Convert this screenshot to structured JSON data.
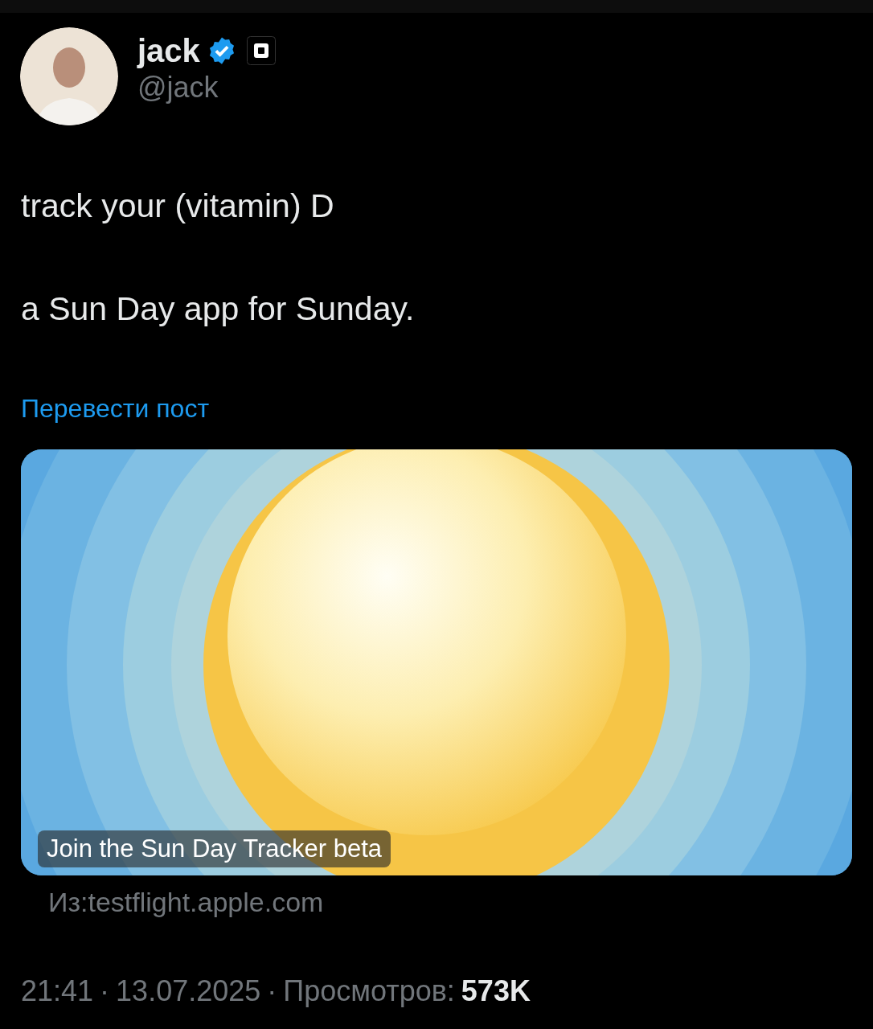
{
  "author": {
    "name": "jack",
    "handle": "@jack",
    "verified": true
  },
  "paragraphs": [
    "track your (vitamin) D",
    "a Sun Day app for Sunday."
  ],
  "translate_link": "Перевести пост",
  "card": {
    "kind": "picture",
    "caption": "Join the Sun Day Tracker beta",
    "source": "Из:testflight.apple.com"
  },
  "meta": [
    {
      "kind": "text",
      "text": "21:41"
    },
    {
      "kind": "sep",
      "text": "·"
    },
    {
      "kind": "text",
      "text": "13.07.2025"
    },
    {
      "kind": "sep",
      "text": "·"
    },
    {
      "kind": "text",
      "text": "Просмотров:"
    },
    {
      "kind": "count",
      "text": "573K"
    }
  ]
}
